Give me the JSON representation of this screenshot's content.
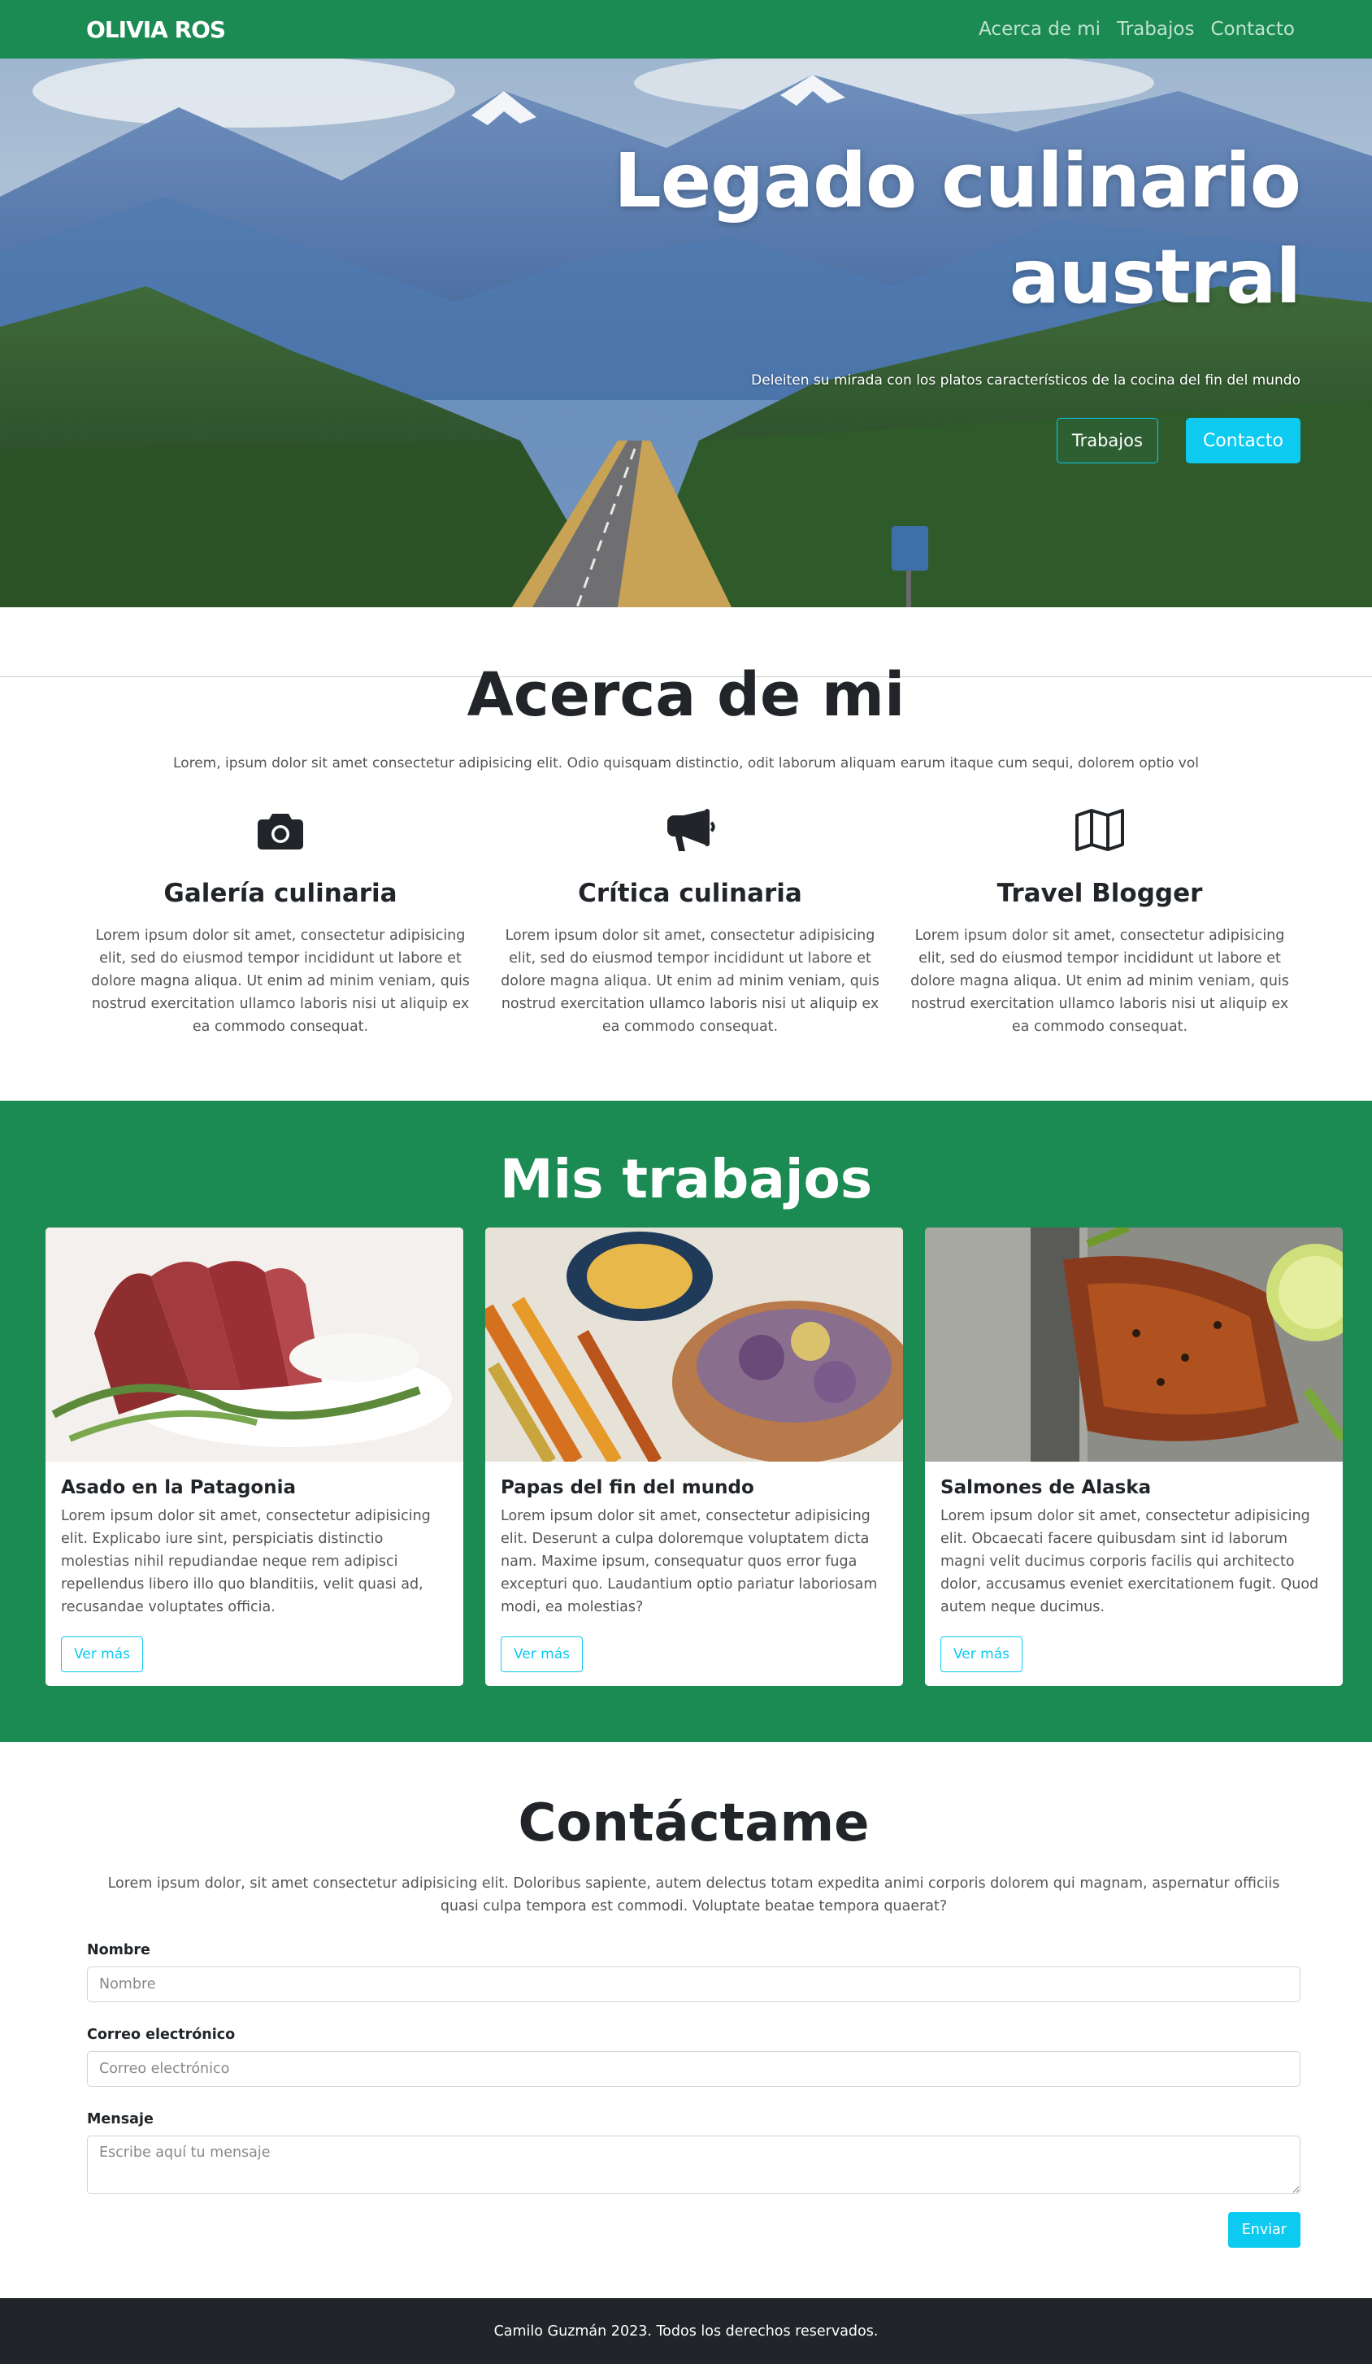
{
  "navbar": {
    "brand": "OLIVIA ROS",
    "links": [
      "Acerca de mi",
      "Trabajos",
      "Contacto"
    ]
  },
  "hero": {
    "title": "Legado culinario austral",
    "subtitle": "Deleiten su mirada con los platos característicos de la cocina del fin del mundo",
    "buttons": [
      "Trabajos",
      "Contacto"
    ]
  },
  "about": {
    "title": "Acerca de mi",
    "intro": "Lorem, ipsum dolor sit amet consectetur adipisicing elit. Odio quisquam distinctio, odit laborum aliquam earum itaque cum sequi, dolorem optio vol",
    "features": [
      {
        "icon": "camera-icon",
        "title": "Galería culinaria",
        "text": "Lorem ipsum dolor sit amet, consectetur adipisicing elit, sed do eiusmod tempor incididunt ut labore et dolore magna aliqua. Ut enim ad minim veniam, quis nostrud exercitation ullamco laboris nisi ut aliquip ex ea commodo consequat."
      },
      {
        "icon": "megaphone-icon",
        "title": "Crítica culinaria",
        "text": "Lorem ipsum dolor sit amet, consectetur adipisicing elit, sed do eiusmod tempor incididunt ut labore et dolore magna aliqua. Ut enim ad minim veniam, quis nostrud exercitation ullamco laboris nisi ut aliquip ex ea commodo consequat."
      },
      {
        "icon": "map-icon",
        "title": "Travel Blogger",
        "text": "Lorem ipsum dolor sit amet, consectetur adipisicing elit, sed do eiusmod tempor incididunt ut labore et dolore magna aliqua. Ut enim ad minim veniam, quis nostrud exercitation ullamco laboris nisi ut aliquip ex ea commodo consequat."
      }
    ]
  },
  "works": {
    "title": "Mis trabajos",
    "cards": [
      {
        "title": "Asado en la Patagonia",
        "text": "Lorem ipsum dolor sit amet, consectetur adipisicing elit. Explicabo iure sint, perspiciatis distinctio molestias nihil repudiandae neque rem adipisci repellendus libero illo quo blanditiis, velit quasi ad, recusandae voluptates officia.",
        "button": "Ver más"
      },
      {
        "title": "Papas del fin del mundo",
        "text": "Lorem ipsum dolor sit amet, consectetur adipisicing elit. Deserunt a culpa doloremque voluptatem dicta nam. Maxime ipsum, consequatur quos error fuga excepturi quo. Laudantium optio pariatur laboriosam modi, ea molestias?",
        "button": "Ver más"
      },
      {
        "title": "Salmones de Alaska",
        "text": "Lorem ipsum dolor sit amet, consectetur adipisicing elit. Obcaecati facere quibusdam sint id laborum magni velit ducimus corporis facilis qui architecto dolor, accusamus eveniet exercitationem fugit. Quod autem neque ducimus.",
        "button": "Ver más"
      }
    ]
  },
  "contact": {
    "title": "Contáctame",
    "intro": "Lorem ipsum dolor, sit amet consectetur adipisicing elit. Doloribus sapiente, autem delectus totam expedita animi corporis dolorem qui magnam, aspernatur officiis quasi culpa tempora est commodi. Voluptate beatae tempora quaerat?",
    "name_label": "Nombre",
    "name_placeholder": "Nombre",
    "email_label": "Correo electrónico",
    "email_placeholder": "Correo electrónico",
    "message_label": "Mensaje",
    "message_placeholder": "Escribe aquí tu mensaje",
    "submit": "Enviar"
  },
  "footer": {
    "text": "Camilo Guzmán 2023. Todos los derechos reservados."
  },
  "colors": {
    "brand_green": "#1b8a53",
    "accent_cyan": "#0dcaf0",
    "footer_dark": "#212529"
  }
}
